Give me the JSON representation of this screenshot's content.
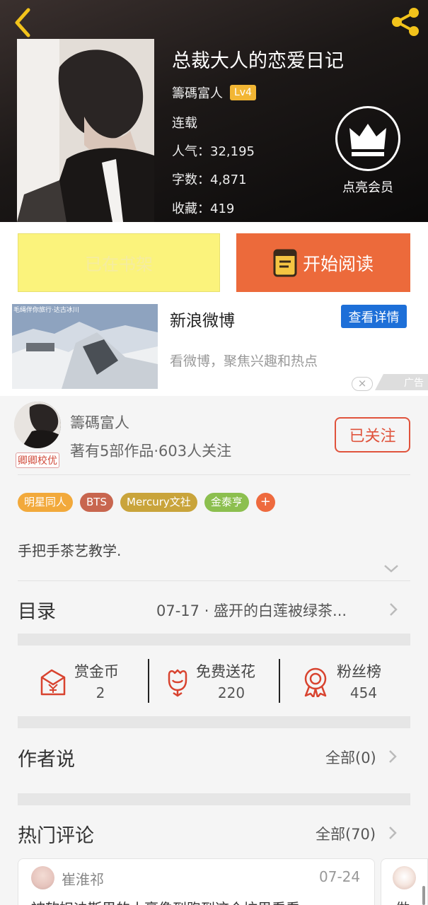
{
  "header": {
    "book_title": "总裁大人的恋爱日记",
    "author": "籌碼富人",
    "level": "Lv4",
    "status": "连载",
    "popularity": "人气：32,195",
    "word_count": "字数：4,871",
    "favorites": "收藏：419",
    "vip_label": "点亮会员",
    "icons": {
      "back": "back-arrow-icon",
      "share": "share-icon",
      "vip": "crown-icon"
    },
    "colors": {
      "accent_icon": "#f2c31b"
    }
  },
  "actions": {
    "shelf_label": "已在书架",
    "read_label": "开始阅读",
    "colors": {
      "shelf_bg": "#fbf37c",
      "read_bg": "#ec6a3b"
    }
  },
  "ad": {
    "image_caption": "毛绳伴你旅行·达古冰川",
    "title": "新浪微博",
    "detail_label": "查看详情",
    "description": "看微博，聚焦兴趣和热点",
    "close_label": "×",
    "mark_label": "广告"
  },
  "author_card": {
    "name": "籌碼富人",
    "avatar_badge": "卿卿校优",
    "stats": "著有5部作品·603人关注",
    "follow_label": "已关注"
  },
  "tags": [
    {
      "label": "明星同人",
      "color": "#f2a93b"
    },
    {
      "label": "BTS",
      "color": "#c8664f"
    },
    {
      "label": "Mercury文社",
      "color": "#c9a43b"
    },
    {
      "label": "金泰亨",
      "color": "#8cbf4f"
    }
  ],
  "tag_more_label": "+",
  "intro": "手把手茶艺教学.",
  "toc": {
    "label": "目录",
    "latest": "07-17 · 盛开的白莲被绿茶..."
  },
  "stats": [
    {
      "name": "赏金币",
      "value": "2",
      "icon": "red-envelope-icon"
    },
    {
      "name": "免费送花",
      "value": "220",
      "icon": "flower-icon"
    },
    {
      "name": "粉丝榜",
      "value": "454",
      "icon": "medal-icon"
    }
  ],
  "author_says": {
    "title": "作者说",
    "more": "全部(0)"
  },
  "hot_comments": {
    "title": "热门评论",
    "more": "全部(70)",
    "items": [
      {
        "user": "崔淮祁",
        "date": "07-24",
        "text": "被软妲迪斯里的小豪像到跑到这个坑里看看"
      },
      {
        "text": "做"
      }
    ]
  }
}
